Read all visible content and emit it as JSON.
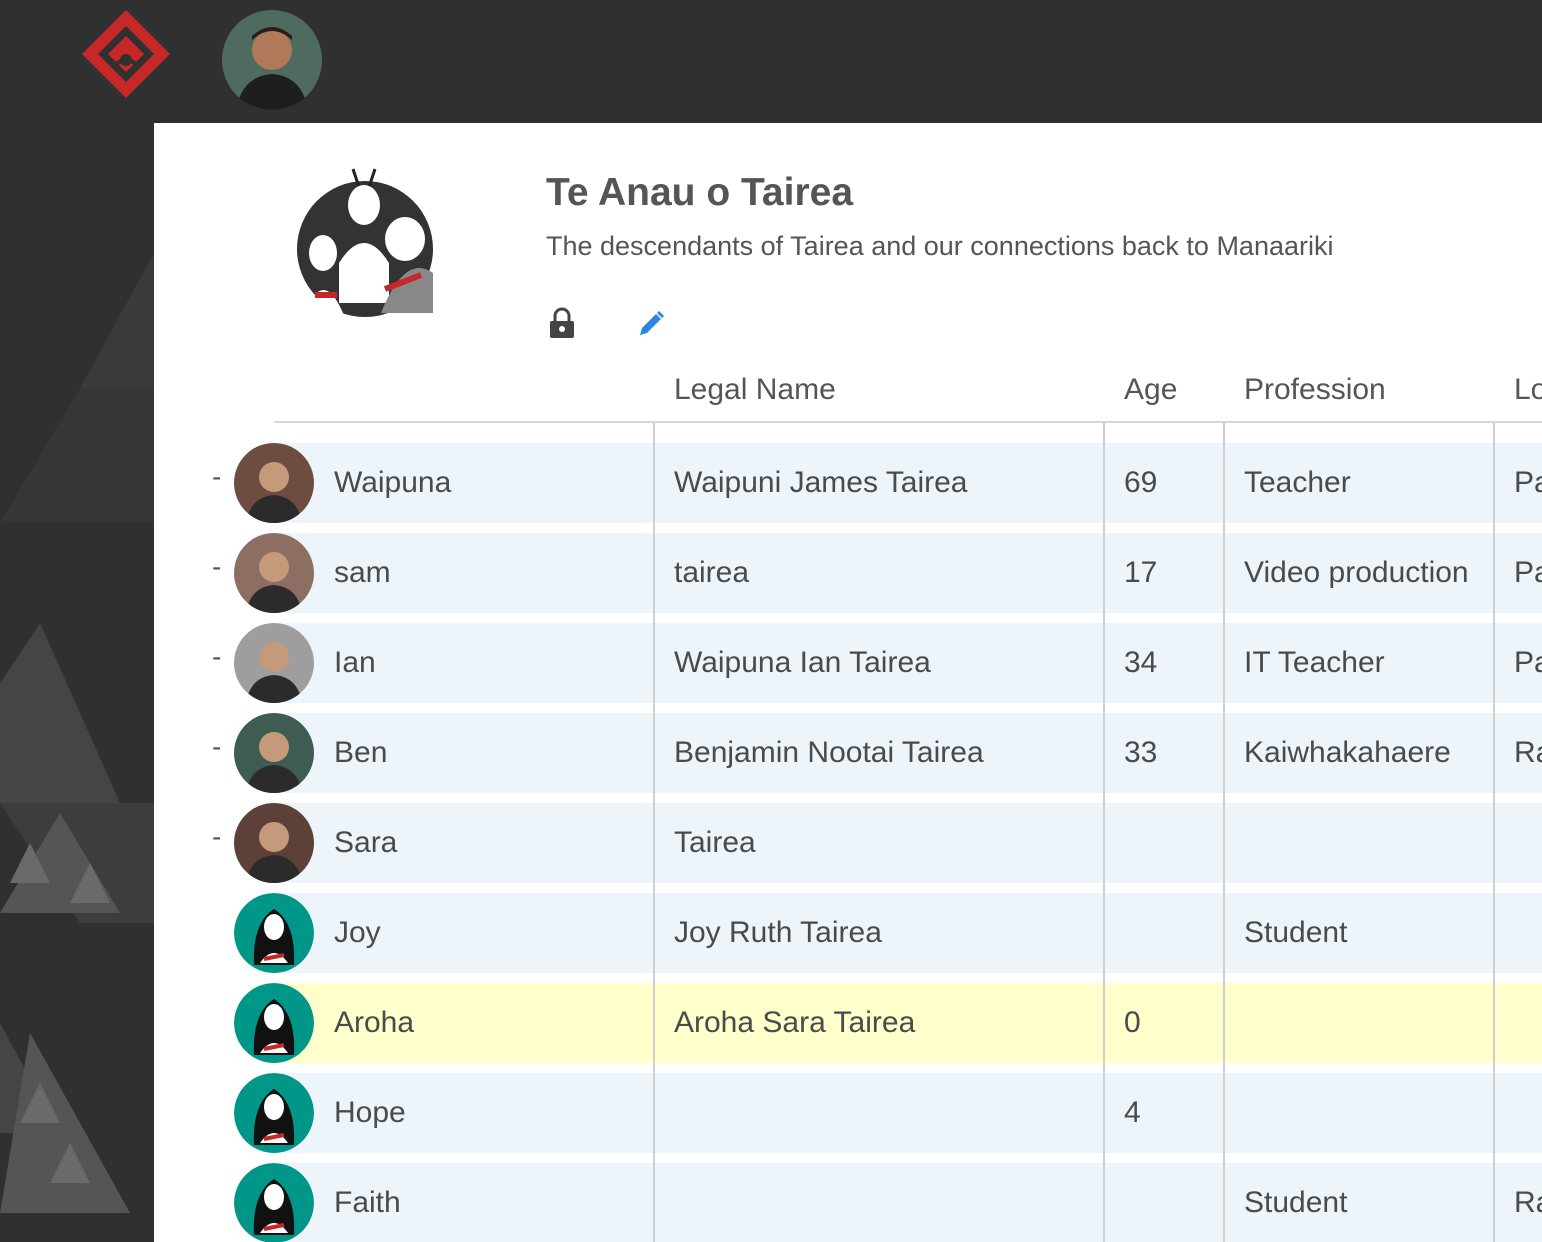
{
  "group": {
    "title": "Te Anau o Tairea",
    "description": "The descendants of Tairea and our connections back to Manaariki"
  },
  "table": {
    "columns": [
      "Legal Name",
      "Age",
      "Profession",
      "Lo"
    ],
    "rows": [
      {
        "name": "Waipuna",
        "legal_name": "Waipuni James Tairea",
        "age": "69",
        "profession": "Teacher",
        "location": "Pa",
        "dash": "-",
        "avatar": "photo"
      },
      {
        "name": "sam",
        "legal_name": "tairea",
        "age": "17",
        "profession": "Video production",
        "location": "Pa",
        "dash": "-",
        "avatar": "photo"
      },
      {
        "name": "Ian",
        "legal_name": "Waipuna Ian Tairea",
        "age": "34",
        "profession": "IT Teacher",
        "location": "Pa",
        "dash": "-",
        "avatar": "photo"
      },
      {
        "name": "Ben",
        "legal_name": "Benjamin Nootai Tairea",
        "age": "33",
        "profession": "Kaiwhakahaere",
        "location": "Ra",
        "dash": "-",
        "avatar": "photo"
      },
      {
        "name": "Sara",
        "legal_name": "Tairea",
        "age": "",
        "profession": "",
        "location": "",
        "dash": "-",
        "avatar": "photo"
      },
      {
        "name": "Joy",
        "legal_name": "Joy Ruth Tairea",
        "age": "",
        "profession": "Student",
        "location": "",
        "dash": "",
        "avatar": "default-female"
      },
      {
        "name": "Aroha",
        "legal_name": "Aroha Sara Tairea",
        "age": "0",
        "profession": "",
        "location": "",
        "dash": "",
        "avatar": "default-female",
        "highlight": true
      },
      {
        "name": "Hope",
        "legal_name": "",
        "age": "4",
        "profession": "",
        "location": "",
        "dash": "",
        "avatar": "default-female"
      },
      {
        "name": "Faith",
        "legal_name": "",
        "age": "",
        "profession": "Student",
        "location": "Ra",
        "dash": "",
        "avatar": "default-female"
      }
    ]
  },
  "icons": {
    "logo": "whakapapa-logo-icon",
    "lock": "lock-icon",
    "edit": "pencil-edit-icon"
  },
  "colors": {
    "topbar": "#303030",
    "row": "#edf5fb",
    "row_highlight": "#ffffcc",
    "accent_edit": "#2e86de",
    "logo_red": "#c62828",
    "avatar_teal": "#009688"
  }
}
